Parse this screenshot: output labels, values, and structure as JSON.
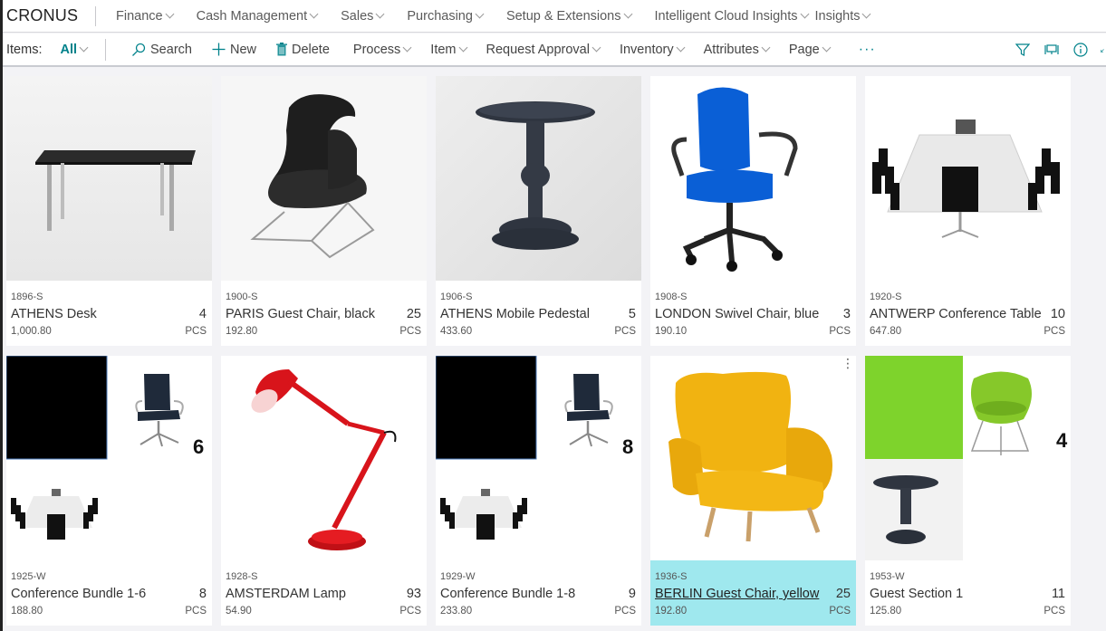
{
  "topnav": {
    "brand": "CRONUS",
    "items": [
      {
        "label": "Finance"
      },
      {
        "label": "Cash Management"
      },
      {
        "label": "Sales"
      },
      {
        "label": "Purchasing"
      },
      {
        "label": "Setup & Extensions"
      },
      {
        "label": "Intelligent Cloud Insights"
      },
      {
        "label": "Insights"
      }
    ]
  },
  "actionbar": {
    "view_label": "Items:",
    "filter_value": "All",
    "search": "Search",
    "new": "New",
    "delete": "Delete",
    "menus": [
      {
        "label": "Process"
      },
      {
        "label": "Item"
      },
      {
        "label": "Request Approval"
      },
      {
        "label": "Inventory"
      },
      {
        "label": "Attributes"
      },
      {
        "label": "Page"
      }
    ],
    "more": "···",
    "right_icons": [
      "filter-icon",
      "factbox-icon",
      "info-icon",
      "collapse-icon"
    ]
  },
  "items": [
    {
      "code": "1896-S",
      "description": "ATHENS Desk",
      "quantity": "4",
      "price": "1,000.80",
      "uom": "PCS",
      "image": "desk"
    },
    {
      "code": "1900-S",
      "description": "PARIS Guest Chair, black",
      "quantity": "25",
      "price": "192.80",
      "uom": "PCS",
      "image": "lounge-chair-black"
    },
    {
      "code": "1906-S",
      "description": "ATHENS Mobile Pedestal",
      "quantity": "5",
      "price": "433.60",
      "uom": "PCS",
      "image": "pedestal"
    },
    {
      "code": "1908-S",
      "description": "LONDON Swivel Chair, blue",
      "quantity": "3",
      "price": "190.10",
      "uom": "PCS",
      "image": "swivel-chair-blue"
    },
    {
      "code": "1920-S",
      "description": "ANTWERP Conference Table",
      "quantity": "10",
      "price": "647.80",
      "uom": "PCS",
      "image": "conference-table"
    },
    {
      "code": "1925-W",
      "description": "Conference Bundle 1-6",
      "quantity": "8",
      "price": "188.80",
      "uom": "PCS",
      "image": "bundle",
      "bundle_count": "6"
    },
    {
      "code": "1928-S",
      "description": "AMSTERDAM Lamp",
      "quantity": "93",
      "price": "54.90",
      "uom": "PCS",
      "image": "lamp"
    },
    {
      "code": "1929-W",
      "description": "Conference Bundle 1-8",
      "quantity": "9",
      "price": "233.80",
      "uom": "PCS",
      "image": "bundle",
      "bundle_count": "8"
    },
    {
      "code": "1936-S",
      "description": "BERLIN Guest Chair, yellow",
      "quantity": "25",
      "price": "192.80",
      "uom": "PCS",
      "image": "wing-chair-yellow",
      "selected": true
    },
    {
      "code": "1953-W",
      "description": "Guest Section 1",
      "quantity": "11",
      "price": "125.80",
      "uom": "PCS",
      "image": "guest-section",
      "bundle_count": "4"
    }
  ],
  "colors": {
    "accent": "#00828b",
    "selected_bg": "#9fe8ee",
    "page_bg": "#f3f3f6"
  }
}
